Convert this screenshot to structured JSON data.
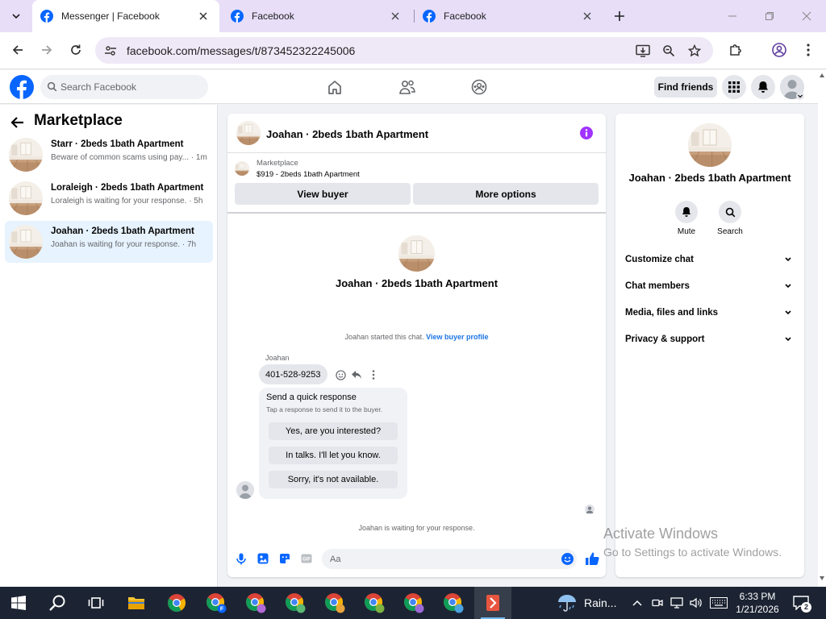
{
  "browser": {
    "tabs": [
      {
        "title": "Messenger | Facebook",
        "active": true
      },
      {
        "title": "Facebook",
        "active": false
      },
      {
        "title": "Facebook",
        "active": false
      }
    ],
    "url": "facebook.com/messages/t/873452322245006"
  },
  "fb_nav": {
    "search_placeholder": "Search Facebook",
    "find_friends": "Find friends"
  },
  "sidebar": {
    "title": "Marketplace",
    "conversations": [
      {
        "name": "Starr · 2beds 1bath Apartment",
        "preview": "Beware of common scams using pay... · 1m"
      },
      {
        "name": "Loraleigh · 2beds 1bath Apartment",
        "preview": "Loraleigh is waiting for your response. · 5h"
      },
      {
        "name": "Joahan · 2beds 1bath Apartment",
        "preview": "Joahan is waiting for your response. · 7h",
        "active": true
      }
    ]
  },
  "chat": {
    "title": "Joahan · 2beds 1bath Apartment",
    "marketplace_label": "Marketplace",
    "listing": "$919 - 2beds 1bath Apartment",
    "view_buyer": "View buyer",
    "more_options": "More options",
    "center_name": "Joahan · 2beds 1bath Apartment",
    "started_text": "Joahan started this chat.",
    "view_buyer_profile": "View buyer profile",
    "sender": "Joahan",
    "message": "401-528-9253",
    "quick_response": {
      "title": "Send a quick response",
      "subtitle": "Tap a response to send it to the buyer.",
      "options": [
        "Yes, are you interested?",
        "In talks. I'll let you know.",
        "Sorry, it's not available."
      ]
    },
    "waiting_text": "Joahan is waiting for your response.",
    "composer_placeholder": "Aa"
  },
  "right_panel": {
    "name": "Joahan · 2beds 1bath Apartment",
    "actions": [
      "Mute",
      "Search"
    ],
    "sections": [
      "Customize chat",
      "Chat members",
      "Media, files and links",
      "Privacy & support"
    ]
  },
  "watermark": {
    "line1": "Activate Windows",
    "line2": "Go to Settings to activate Windows."
  },
  "taskbar": {
    "weather": "Rain...",
    "time": "6:33 PM",
    "date": "1/21/2026",
    "notifications": "2"
  },
  "colors": {
    "fb_blue": "#0866ff",
    "messenger_purple": "#a033ff",
    "tab_strip": "#e8def8",
    "taskbar": "#1c2433"
  }
}
